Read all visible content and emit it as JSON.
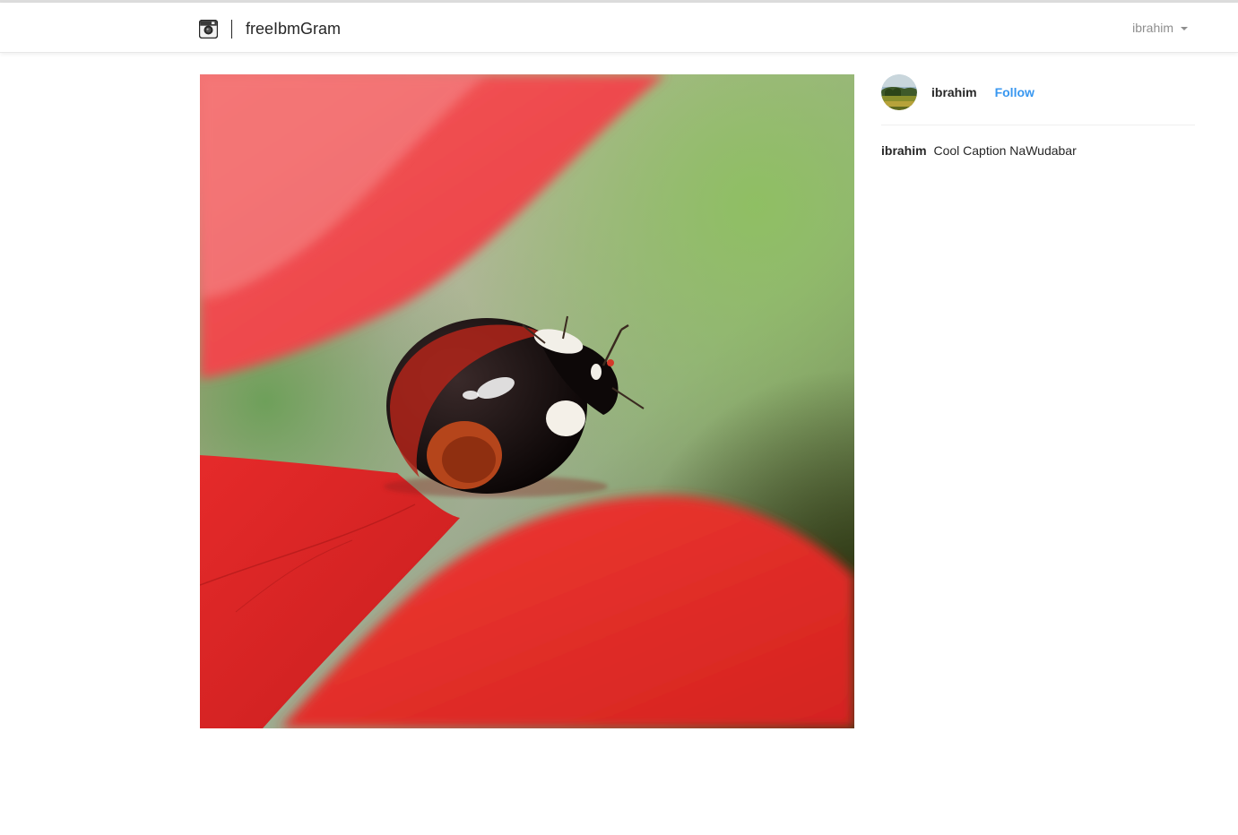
{
  "navbar": {
    "brand_icon": "camera-icon",
    "brand_name": "freeIbmGram",
    "user_menu_label": "ibrahim"
  },
  "post": {
    "image_subject": "ladybug",
    "author": "ibrahim",
    "follow_label": "Follow",
    "caption_user": "ibrahim",
    "caption_text": "Cool Caption NaWudabar"
  },
  "colors": {
    "accent": "#3897f0",
    "text": "#262626",
    "muted": "#8e8e8e"
  }
}
